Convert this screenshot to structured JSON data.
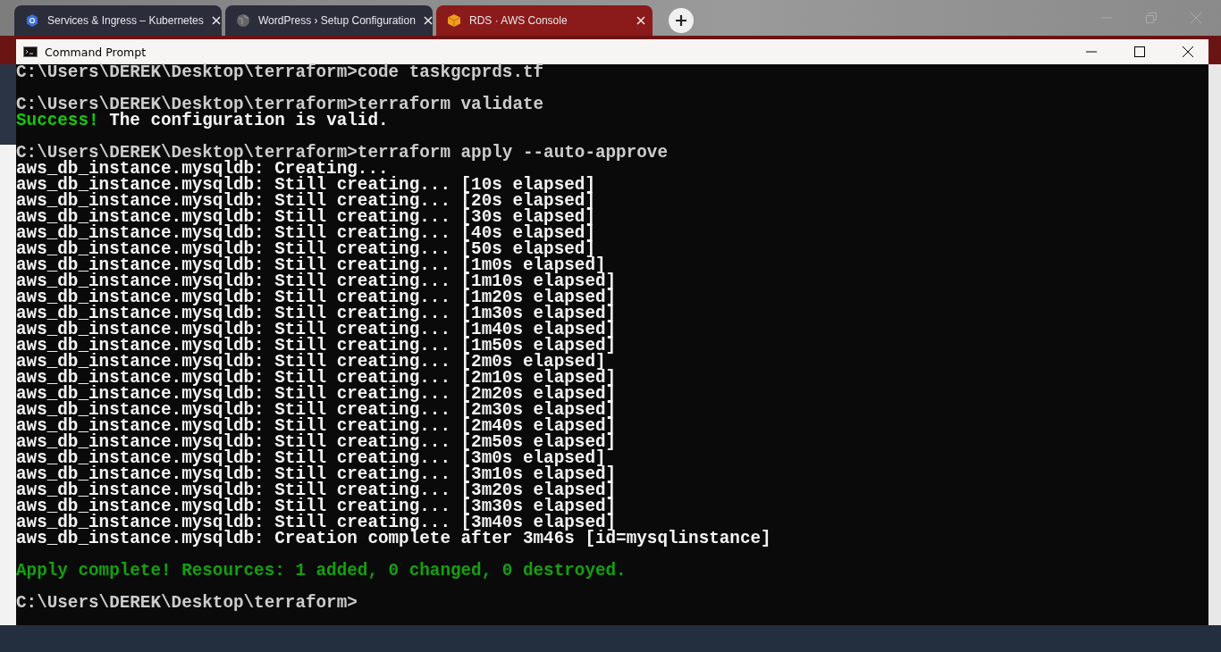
{
  "browser": {
    "tabs": [
      {
        "title": "Services & Ingress – Kubernetes",
        "selected": false
      },
      {
        "title": "WordPress › Setup Configuration",
        "selected": false
      },
      {
        "title": "RDS · AWS Console",
        "selected": true
      }
    ]
  },
  "console_window": {
    "title": "Command Prompt",
    "blocks": [
      [
        {
          "segments": [
            {
              "kind": "prompt",
              "text": "C:\\Users\\DEREK\\Desktop\\terraform>code taskgcprds.tf"
            }
          ]
        }
      ],
      [
        {
          "segments": [
            {
              "kind": "prompt",
              "text": "C:\\Users\\DEREK\\Desktop\\terraform>terraform validate"
            }
          ]
        },
        {
          "segments": [
            {
              "kind": "success",
              "text": "Success!"
            },
            {
              "kind": "output",
              "text": " The configuration is valid."
            }
          ]
        }
      ],
      [
        {
          "segments": [
            {
              "kind": "prompt",
              "text": "C:\\Users\\DEREK\\Desktop\\terraform>terraform apply --auto-approve"
            }
          ]
        },
        {
          "segments": [
            {
              "kind": "output",
              "text": "aws_db_instance.mysqldb: Creating..."
            }
          ]
        },
        {
          "segments": [
            {
              "kind": "output",
              "text": "aws_db_instance.mysqldb: Still creating... [10s elapsed]"
            }
          ]
        },
        {
          "segments": [
            {
              "kind": "output",
              "text": "aws_db_instance.mysqldb: Still creating... [20s elapsed]"
            }
          ]
        },
        {
          "segments": [
            {
              "kind": "output",
              "text": "aws_db_instance.mysqldb: Still creating... [30s elapsed]"
            }
          ]
        },
        {
          "segments": [
            {
              "kind": "output",
              "text": "aws_db_instance.mysqldb: Still creating... [40s elapsed]"
            }
          ]
        },
        {
          "segments": [
            {
              "kind": "output",
              "text": "aws_db_instance.mysqldb: Still creating... [50s elapsed]"
            }
          ]
        },
        {
          "segments": [
            {
              "kind": "output",
              "text": "aws_db_instance.mysqldb: Still creating... [1m0s elapsed]"
            }
          ]
        },
        {
          "segments": [
            {
              "kind": "output",
              "text": "aws_db_instance.mysqldb: Still creating... [1m10s elapsed]"
            }
          ]
        },
        {
          "segments": [
            {
              "kind": "output",
              "text": "aws_db_instance.mysqldb: Still creating... [1m20s elapsed]"
            }
          ]
        },
        {
          "segments": [
            {
              "kind": "output",
              "text": "aws_db_instance.mysqldb: Still creating... [1m30s elapsed]"
            }
          ]
        },
        {
          "segments": [
            {
              "kind": "output",
              "text": "aws_db_instance.mysqldb: Still creating... [1m40s elapsed]"
            }
          ]
        },
        {
          "segments": [
            {
              "kind": "output",
              "text": "aws_db_instance.mysqldb: Still creating... [1m50s elapsed]"
            }
          ]
        },
        {
          "segments": [
            {
              "kind": "output",
              "text": "aws_db_instance.mysqldb: Still creating... [2m0s elapsed]"
            }
          ]
        },
        {
          "segments": [
            {
              "kind": "output",
              "text": "aws_db_instance.mysqldb: Still creating... [2m10s elapsed]"
            }
          ]
        },
        {
          "segments": [
            {
              "kind": "output",
              "text": "aws_db_instance.mysqldb: Still creating... [2m20s elapsed]"
            }
          ]
        },
        {
          "segments": [
            {
              "kind": "output",
              "text": "aws_db_instance.mysqldb: Still creating... [2m30s elapsed]"
            }
          ]
        },
        {
          "segments": [
            {
              "kind": "output",
              "text": "aws_db_instance.mysqldb: Still creating... [2m40s elapsed]"
            }
          ]
        },
        {
          "segments": [
            {
              "kind": "output",
              "text": "aws_db_instance.mysqldb: Still creating... [2m50s elapsed]"
            }
          ]
        },
        {
          "segments": [
            {
              "kind": "output",
              "text": "aws_db_instance.mysqldb: Still creating... [3m0s elapsed]"
            }
          ]
        },
        {
          "segments": [
            {
              "kind": "output",
              "text": "aws_db_instance.mysqldb: Still creating... [3m10s elapsed]"
            }
          ]
        },
        {
          "segments": [
            {
              "kind": "output",
              "text": "aws_db_instance.mysqldb: Still creating... [3m20s elapsed]"
            }
          ]
        },
        {
          "segments": [
            {
              "kind": "output",
              "text": "aws_db_instance.mysqldb: Still creating... [3m30s elapsed]"
            }
          ]
        },
        {
          "segments": [
            {
              "kind": "output",
              "text": "aws_db_instance.mysqldb: Still creating... [3m40s elapsed]"
            }
          ]
        },
        {
          "segments": [
            {
              "kind": "output",
              "text": "aws_db_instance.mysqldb: Creation complete after 3m46s [id=mysqlinstance]"
            }
          ]
        }
      ],
      [
        {
          "segments": [
            {
              "kind": "complete",
              "text": "Apply complete! Resources: 1 added, 0 changed, 0 destroyed."
            }
          ]
        }
      ],
      [
        {
          "segments": [
            {
              "kind": "prompt",
              "text": "C:\\Users\\DEREK\\Desktop\\terraform>"
            }
          ]
        }
      ]
    ]
  }
}
